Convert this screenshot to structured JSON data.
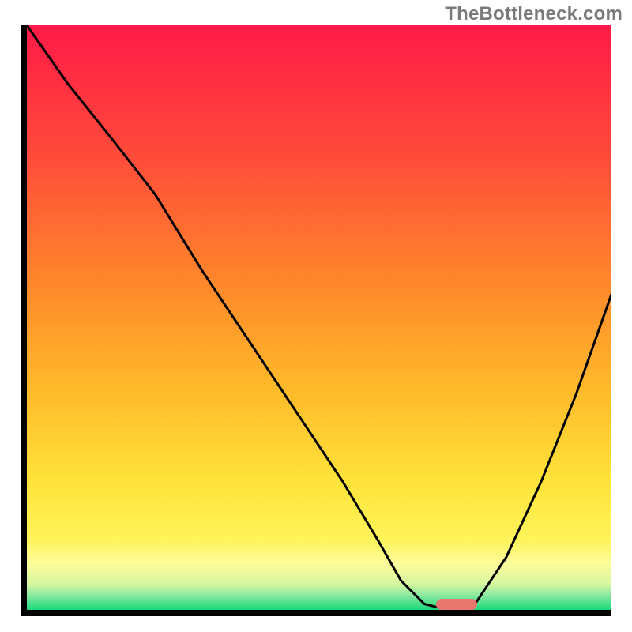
{
  "watermark": "TheBottleneck.com",
  "chart_data": {
    "type": "line",
    "title": "",
    "xlabel": "",
    "ylabel": "",
    "xlim": [
      0,
      100
    ],
    "ylim": [
      0,
      100
    ],
    "grid": false,
    "legend": false,
    "background_gradient": {
      "stops": [
        {
          "pos": 0.0,
          "color": "#ff1a47"
        },
        {
          "pos": 0.22,
          "color": "#ff4a3a"
        },
        {
          "pos": 0.45,
          "color": "#ff8a2a"
        },
        {
          "pos": 0.62,
          "color": "#ffb92a"
        },
        {
          "pos": 0.78,
          "color": "#ffe33a"
        },
        {
          "pos": 0.88,
          "color": "#fff45a"
        },
        {
          "pos": 0.92,
          "color": "#fdfc9a"
        },
        {
          "pos": 0.955,
          "color": "#d8f7a0"
        },
        {
          "pos": 0.975,
          "color": "#8be9a0"
        },
        {
          "pos": 1.0,
          "color": "#18d879"
        }
      ]
    },
    "series": [
      {
        "name": "bottleneck-curve",
        "color": "#000000",
        "x": [
          0,
          7,
          15,
          22,
          30,
          38,
          46,
          54,
          60,
          64,
          68,
          72,
          76,
          82,
          88,
          94,
          100
        ],
        "y": [
          100,
          90,
          80,
          71,
          58,
          46,
          34,
          22,
          12,
          5,
          1,
          0,
          0,
          9,
          22,
          37,
          54
        ]
      }
    ],
    "marker": {
      "name": "optimal-point",
      "x_start": 70,
      "x_end": 77,
      "y": 0,
      "color": "#e9766f"
    }
  }
}
